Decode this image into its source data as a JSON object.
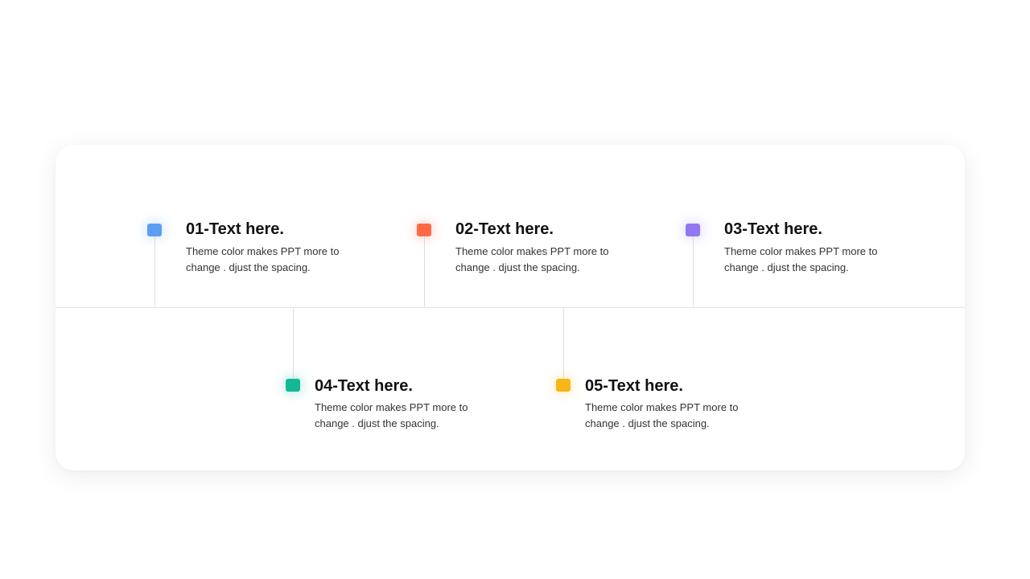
{
  "items": [
    {
      "title": "01-Text here.",
      "desc": "Theme  color makes PPT more to\nchange . djust the spacing.",
      "color": "#5b9ef2"
    },
    {
      "title": "02-Text here.",
      "desc": "Theme  color makes PPT more to\nchange . djust the spacing.",
      "color": "#ff6a45"
    },
    {
      "title": "03-Text here.",
      "desc": "Theme  color makes PPT more to\nchange . djust the spacing.",
      "color": "#9178ef"
    },
    {
      "title": "04-Text here.",
      "desc": "Theme  color makes PPT more to\nchange . djust the spacing.",
      "color": "#13b994"
    },
    {
      "title": "05-Text here.",
      "desc": "Theme  color makes PPT more to\nchange . djust the spacing.",
      "color": "#f7b516"
    }
  ]
}
